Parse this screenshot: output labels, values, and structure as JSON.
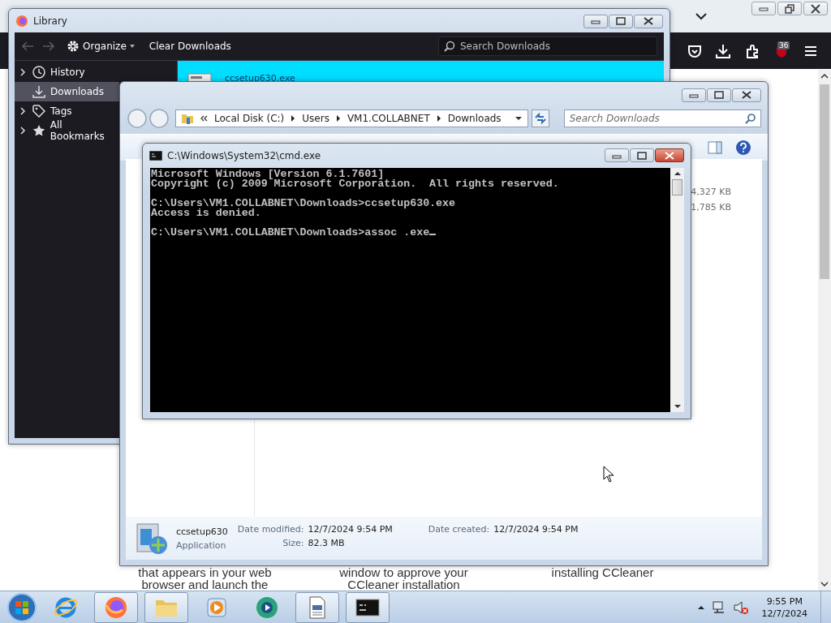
{
  "browser": {
    "badge": "36",
    "page_columns": [
      [
        "that appears in your web",
        "browser and launch the"
      ],
      [
        "window to approve your",
        "CCleaner installation"
      ],
      [
        "installing CCleaner"
      ]
    ]
  },
  "library": {
    "title": "Library",
    "organize": "Organize",
    "clear": "Clear Downloads",
    "search_placeholder": "Search Downloads",
    "sidebar": [
      {
        "label": "History",
        "kind": "history",
        "expandable": true,
        "selected": false
      },
      {
        "label": "Downloads",
        "kind": "downloads",
        "expandable": false,
        "selected": true
      },
      {
        "label": "Tags",
        "kind": "tags",
        "expandable": true,
        "selected": false
      },
      {
        "label": "All Bookmarks",
        "kind": "bookmarks",
        "expandable": true,
        "selected": false
      }
    ],
    "downloads": [
      {
        "name": "ccsetup630.exe",
        "selected": true
      }
    ]
  },
  "explorer": {
    "breadcrumb": [
      "Local Disk (C:)",
      "Users",
      "VM1.COLLABNET",
      "Downloads"
    ],
    "search_placeholder": "Search Downloads",
    "sizes": [
      "4,327 KB",
      "1,785 KB"
    ],
    "details": {
      "name": "ccsetup630",
      "type": "Application",
      "modified_label": "Date modified:",
      "modified": "12/7/2024 9:54 PM",
      "size_label": "Size:",
      "size": "82.3 MB",
      "created_label": "Date created:",
      "created": "12/7/2024 9:54 PM"
    }
  },
  "console": {
    "title": "C:\\Windows\\System32\\cmd.exe",
    "blocks": [
      [
        "Microsoft Windows [Version 6.1.7601]",
        "Copyright (c) 2009 Microsoft Corporation.  All rights reserved."
      ],
      [
        "C:\\Users\\VM1.COLLABNET\\Downloads>ccsetup630.exe",
        "Access is denied."
      ],
      [
        "C:\\Users\\VM1.COLLABNET\\Downloads>assoc .exe"
      ]
    ]
  },
  "taskbar": {
    "items": [
      {
        "kind": "ie",
        "running": false
      },
      {
        "kind": "firefox",
        "running": true
      },
      {
        "kind": "folder",
        "running": true
      },
      {
        "kind": "media",
        "running": false
      },
      {
        "kind": "green",
        "running": false
      },
      {
        "kind": "document",
        "running": true
      },
      {
        "kind": "console",
        "running": true
      }
    ],
    "time": "9:55 PM",
    "date": "12/7/2024"
  }
}
